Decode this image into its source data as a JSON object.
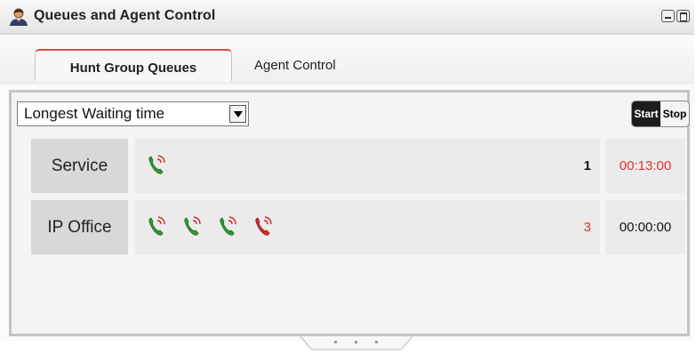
{
  "window": {
    "title": "Queues and Agent Control",
    "title_icon": "agent-icon",
    "minimize_icon": "minimize-icon",
    "maximize_icon": "maximize-icon"
  },
  "tabs": [
    {
      "label": "Hunt Group Queues",
      "active": true
    },
    {
      "label": "Agent Control",
      "active": false
    }
  ],
  "sort": {
    "selected": "Longest Waiting time"
  },
  "controls": {
    "start_label": "Start",
    "stop_label": "Stop"
  },
  "queues": [
    {
      "name": "Service",
      "calls": [
        "phone-ringing-icon"
      ],
      "count": "1",
      "time": "00:13:00"
    },
    {
      "name": "IP Office",
      "calls": [
        "phone-ringing-icon",
        "phone-ringing-icon",
        "phone-ringing-icon",
        "phone-alerting-icon"
      ],
      "count": "3",
      "time": "00:00:00"
    }
  ],
  "colors": {
    "alert_red": "#e03030",
    "tab_accent": "#e0474b",
    "phone_green": "#2e9a2e",
    "phone_red": "#d62a2a"
  }
}
